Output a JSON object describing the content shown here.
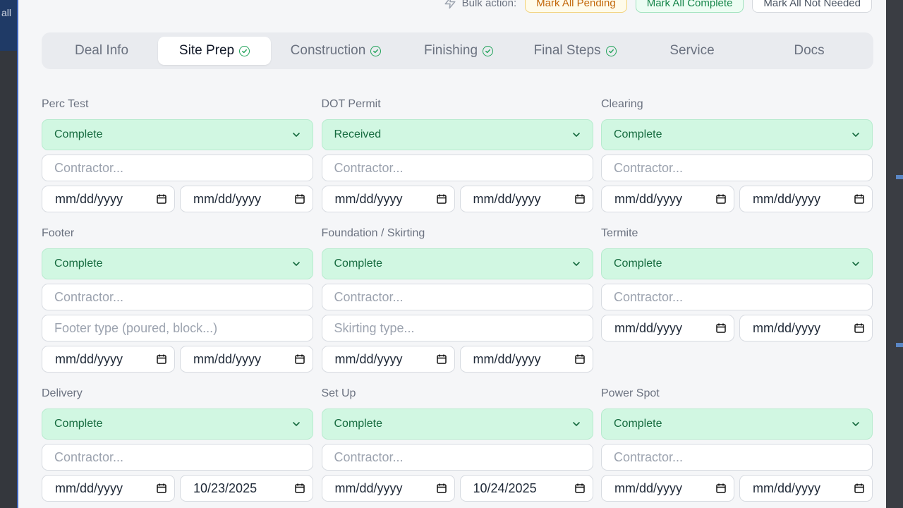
{
  "bulk": {
    "label": "Bulk action:",
    "pending": "Mark All Pending",
    "complete": "Mark All Complete",
    "not_needed": "Mark All Not Needed"
  },
  "background": {
    "left_text": "all"
  },
  "tabs": [
    {
      "label": "Deal Info",
      "checked": false,
      "active": false
    },
    {
      "label": "Site Prep",
      "checked": true,
      "active": true
    },
    {
      "label": "Construction",
      "checked": true,
      "active": false
    },
    {
      "label": "Finishing",
      "checked": true,
      "active": false
    },
    {
      "label": "Final Steps",
      "checked": true,
      "active": false
    },
    {
      "label": "Service",
      "checked": false,
      "active": false
    },
    {
      "label": "Docs",
      "checked": false,
      "active": false
    }
  ],
  "cards": [
    {
      "label": "Perc Test",
      "status": "Complete",
      "contractor_placeholder": "Contractor...",
      "date1": "mm/dd/yyyy",
      "date2": "mm/dd/yyyy"
    },
    {
      "label": "DOT Permit",
      "status": "Received",
      "contractor_placeholder": "Contractor...",
      "date1": "mm/dd/yyyy",
      "date2": "mm/dd/yyyy"
    },
    {
      "label": "Clearing",
      "status": "Complete",
      "contractor_placeholder": "Contractor...",
      "date1": "mm/dd/yyyy",
      "date2": "mm/dd/yyyy"
    },
    {
      "label": "Footer",
      "status": "Complete",
      "contractor_placeholder": "Contractor...",
      "extra_placeholder": "Footer type (poured, block...)",
      "date1": "mm/dd/yyyy",
      "date2": "mm/dd/yyyy"
    },
    {
      "label": "Foundation / Skirting",
      "status": "Complete",
      "contractor_placeholder": "Contractor...",
      "extra_placeholder": "Skirting type...",
      "date1": "mm/dd/yyyy",
      "date2": "mm/dd/yyyy"
    },
    {
      "label": "Termite",
      "status": "Complete",
      "contractor_placeholder": "Contractor...",
      "date1": "mm/dd/yyyy",
      "date2": "mm/dd/yyyy"
    },
    {
      "label": "Delivery",
      "status": "Complete",
      "contractor_placeholder": "Contractor...",
      "date1": "mm/dd/yyyy",
      "date2": "10/23/2025"
    },
    {
      "label": "Set Up",
      "status": "Complete",
      "contractor_placeholder": "Contractor...",
      "date1": "mm/dd/yyyy",
      "date2": "10/24/2025"
    },
    {
      "label": "Power Spot",
      "status": "Complete",
      "contractor_placeholder": "Contractor...",
      "date1": "mm/dd/yyyy",
      "date2": "mm/dd/yyyy"
    }
  ],
  "colors": {
    "status_bg": "#d1f7e2",
    "status_text": "#166b3f",
    "check": "#22a35a",
    "accent_border": "#3d63b8"
  },
  "icons": {
    "tab_check": "check-circle-icon",
    "status_chevron": "chevron-down-icon",
    "date": "calendar-icon",
    "bulk": "bolt-icon"
  }
}
